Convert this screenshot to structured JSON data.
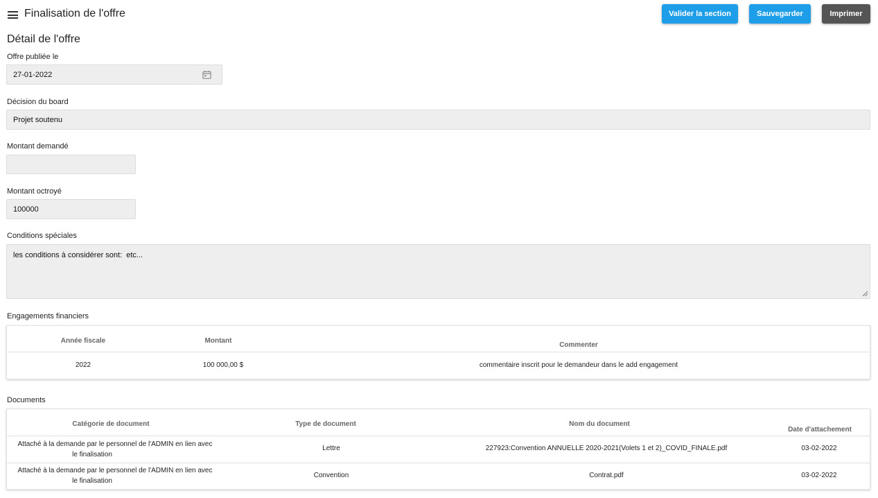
{
  "header": {
    "title": "Finalisation de l'offre",
    "buttons": {
      "validate": "Valider la section",
      "save": "Sauvegarder",
      "print": "Imprimer"
    }
  },
  "section": {
    "title": "Détail de l'offre"
  },
  "form": {
    "published_label": "Offre publiée le",
    "published_value": "27-01-2022",
    "board_label": "Décision du board",
    "board_value": "Projet soutenu",
    "requested_label": "Montant demandé",
    "requested_value": "",
    "granted_label": "Montant octroyé",
    "granted_value": "100000",
    "conditions_label": "Conditions spéciales",
    "conditions_value": "les conditions à considérer sont:  etc..."
  },
  "engagements": {
    "label": "Engagements financiers",
    "headers": [
      "Année fiscale",
      "Montant",
      "Commenter"
    ],
    "rows": [
      [
        "2022",
        "100 000,00 $",
        "commentaire inscrit pour le demandeur dans le add engagement"
      ]
    ]
  },
  "documents": {
    "label": "Documents",
    "headers": [
      "Catégorie de document",
      "Type de document",
      "Nom du document",
      "Date d'attachement"
    ],
    "rows": [
      [
        "Attaché à la demande par le personnel de l'ADMIN en lien avec",
        "le finalisation",
        "Lettre",
        "227923:Convention ANNUELLE 2020-2021(Volets 1 et 2)_COVID_FINALE.pdf",
        "03-02-2022"
      ],
      [
        "Attaché à la demande par le personnel de l'ADMIN en lien avec",
        "le finalisation",
        "Convention",
        "Contrat.pdf",
        "03-02-2022"
      ]
    ]
  },
  "colors": {
    "primary_button": "#1e9ee8",
    "print_button": "#555555",
    "field_background": "#eeeeee",
    "link": "#b22222"
  },
  "icons": [
    "menu-icon",
    "calendar-icon",
    "resize-handle-icon"
  ]
}
